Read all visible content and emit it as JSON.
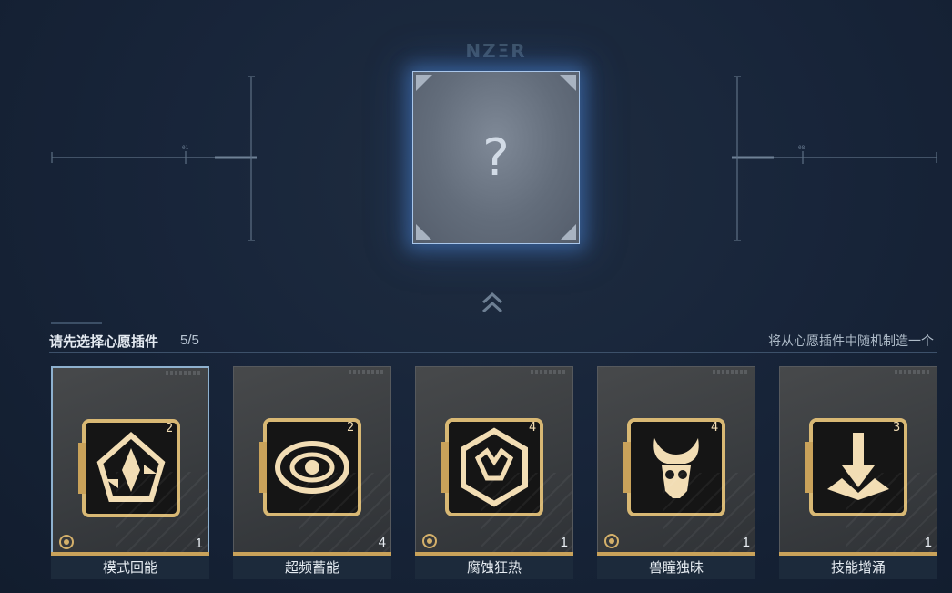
{
  "brand": "NZΞR",
  "center_card": {
    "symbol": "?"
  },
  "section": {
    "title": "请先选择心愿插件",
    "count": "5/5",
    "hint": "将从心愿插件中随机制造一个"
  },
  "cards": [
    {
      "name": "模式回能",
      "qty": "1",
      "level": "2",
      "icon": "cycle-burst-icon",
      "selected": true,
      "has_mark": true
    },
    {
      "name": "超频蓄能",
      "qty": "4",
      "level": "2",
      "icon": "eye-icon",
      "selected": false,
      "has_mark": false
    },
    {
      "name": "腐蚀狂热",
      "qty": "1",
      "level": "4",
      "icon": "corrosion-emblem-icon",
      "selected": false,
      "has_mark": true
    },
    {
      "name": "兽瞳独昧",
      "qty": "1",
      "level": "4",
      "icon": "demon-skull-icon",
      "selected": false,
      "has_mark": true
    },
    {
      "name": "技能增涌",
      "qty": "1",
      "level": "3",
      "icon": "skill-surge-icon",
      "selected": false,
      "has_mark": false
    }
  ],
  "colors": {
    "gold": "#c9a25a",
    "glow": "#5a8fd8",
    "selected_border": "#8eb1cf"
  }
}
